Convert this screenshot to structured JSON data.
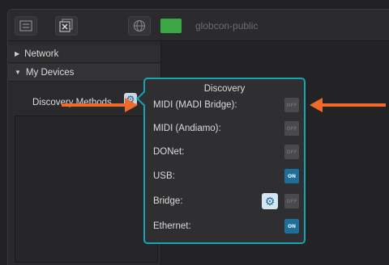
{
  "toolbar": {
    "device_name": "globcon-public",
    "buttons": [
      {
        "icon": "device-list-icon"
      },
      {
        "icon": "close-window-icon"
      },
      {
        "icon": "globe-icon"
      }
    ],
    "status_color": "#3aa646"
  },
  "sidebar": {
    "items": [
      {
        "label": "Network",
        "expanded": false
      },
      {
        "label": "My Devices",
        "expanded": true
      }
    ],
    "discovery_label": "Discovery Methods"
  },
  "popover": {
    "title": "Discovery",
    "methods": [
      {
        "label": "MIDI (MADI Bridge):",
        "state": "OFF"
      },
      {
        "label": "MIDI (Andiamo):",
        "state": "OFF"
      },
      {
        "label": "DONet:",
        "state": "OFF"
      },
      {
        "label": "USB:",
        "state": "ON"
      },
      {
        "label": "Bridge:",
        "state": "OFF",
        "has_settings": true
      },
      {
        "label": "Ethernet:",
        "state": "ON"
      }
    ]
  },
  "colors": {
    "accent_border": "#16a5b6",
    "on_toggle": "#1e6f97",
    "annotation_arrow": "#ef6a2b"
  }
}
